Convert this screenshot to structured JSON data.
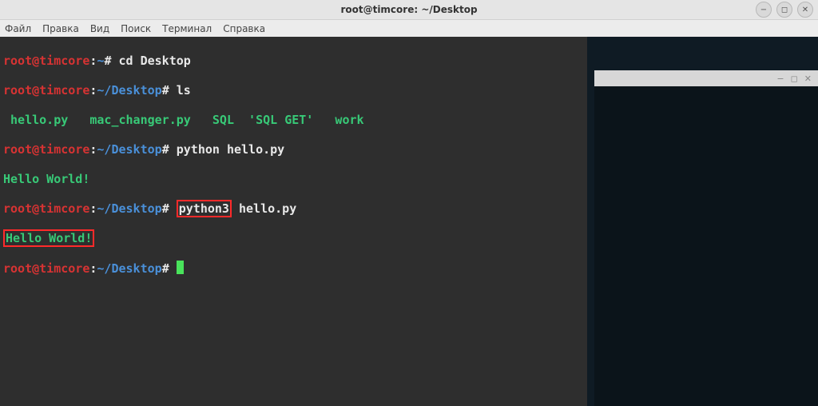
{
  "window": {
    "title": "root@timcore: ~/Desktop",
    "controls": {
      "min": "−",
      "max": "◻",
      "close": "✕"
    }
  },
  "menubar": {
    "items": [
      "Файл",
      "Правка",
      "Вид",
      "Поиск",
      "Терминал",
      "Справка"
    ]
  },
  "prompt": {
    "user_host": "root@timcore",
    "path_home": "~",
    "path_desktop": "~/Desktop",
    "symbol": "#"
  },
  "session": {
    "cmd1": "cd Desktop",
    "cmd2": "ls",
    "ls_output": " hello.py   mac_changer.py   SQL  'SQL GET'   work",
    "cmd3": "python hello.py",
    "out3": "Hello World!",
    "cmd4_a": "python3",
    "cmd4_b": " hello.py",
    "out4": "Hello World!"
  }
}
